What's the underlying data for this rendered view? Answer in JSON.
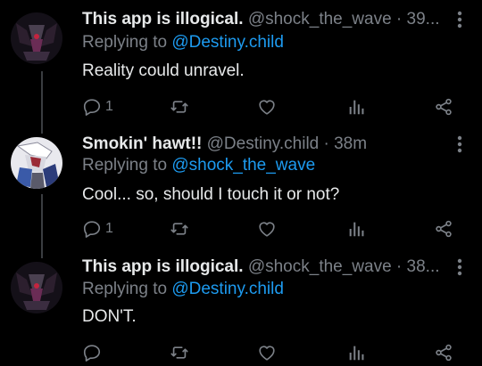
{
  "tweets": [
    {
      "name": "This app is illogical.",
      "handle": "@shock_the_wave · 39...",
      "reply_prefix": "Replying to",
      "reply_to": "@Destiny.child",
      "text": "Reality could unravel.",
      "reply_count": "1"
    },
    {
      "name": "Smokin' hawt!!",
      "handle": "@Destiny.child · 38m",
      "reply_prefix": "Replying to",
      "reply_to": "@shock_the_wave",
      "text": "Cool... so, should I touch it or not?",
      "reply_count": "1"
    },
    {
      "name": "This app is illogical.",
      "handle": "@shock_the_wave · 38...",
      "reply_prefix": "Replying to",
      "reply_to": "@Destiny.child",
      "text": "DON'T.",
      "reply_count": ""
    }
  ],
  "icons": {
    "more": "more-icon",
    "reply": "reply-icon",
    "retweet": "retweet-icon",
    "like": "like-icon",
    "analytics": "analytics-icon",
    "share": "share-icon"
  },
  "colors": {
    "background": "#000000",
    "link": "#1d9bf0",
    "muted": "#7c8188",
    "text": "#e7e9ea"
  }
}
